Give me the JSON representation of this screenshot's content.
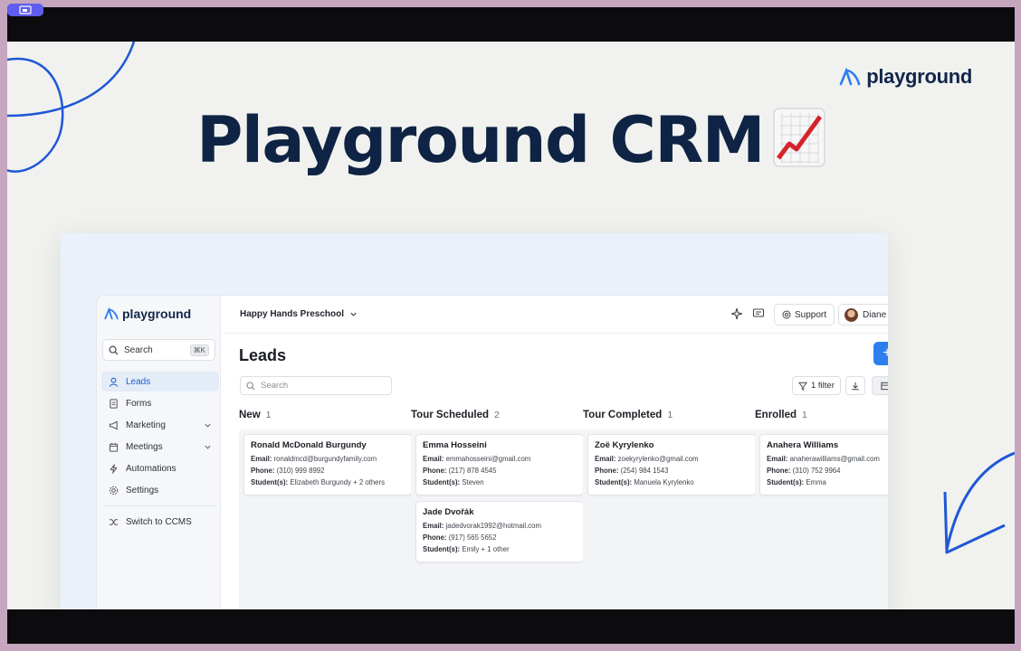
{
  "colors": {
    "accent": "#2d7ff0",
    "brand_navy": "#0f2444",
    "deco_blue": "#1f57d6"
  },
  "slide": {
    "brand": "playground",
    "headline": "Playground CRM",
    "headline_emoji": "chart-increasing-icon"
  },
  "app": {
    "sidebar": {
      "logo": "playground",
      "search_label": "Search",
      "search_shortcut": "⌘K",
      "items": [
        {
          "label": "Leads",
          "icon": "user-icon",
          "active": true
        },
        {
          "label": "Forms",
          "icon": "document-icon"
        },
        {
          "label": "Marketing",
          "icon": "megaphone-icon",
          "expandable": true
        },
        {
          "label": "Meetings",
          "icon": "calendar-icon",
          "expandable": true
        },
        {
          "label": "Automations",
          "icon": "lightning-icon"
        },
        {
          "label": "Settings",
          "icon": "gear-icon"
        }
      ],
      "switch_label": "Switch to CCMS"
    },
    "topbar": {
      "school": "Happy Hands Preschool",
      "support": "Support",
      "user": "Diane"
    },
    "page_title": "Leads",
    "add_button": "+",
    "search_placeholder": "Search",
    "filter_label": "1 filter",
    "columns": [
      {
        "title": "New",
        "count": "1",
        "cards": [
          {
            "name": "Ronald McDonald Burgundy",
            "email": "ronaldmcd@burgundyfamily.com",
            "phone": "(310) 999 8992",
            "students": "Elizabeth Burgundy + 2 others"
          }
        ]
      },
      {
        "title": "Tour Scheduled",
        "count": "2",
        "cards": [
          {
            "name": "Emma Hosseini",
            "email": "emmahosseini@gmail.com",
            "phone": "(217) 878 4545",
            "students": "Steven"
          },
          {
            "name": "Jade Dvořák",
            "email": "jadedvorak1992@hotmail.com",
            "phone": "(917) 565 5652",
            "students": "Emily + 1 other"
          }
        ]
      },
      {
        "title": "Tour Completed",
        "count": "1",
        "cards": [
          {
            "name": "Zoë Kyrylenko",
            "email": "zoekyrylenko@gmail.com",
            "phone": "(254) 984 1543",
            "students": "Manuela Kyrylenko"
          }
        ]
      },
      {
        "title": "Enrolled",
        "count": "1",
        "cards": [
          {
            "name": "Anahera Williams",
            "email": "anaherawilliams@gmail.com",
            "phone": "(310) 752 9964",
            "students": "Emma"
          }
        ]
      }
    ],
    "field_labels": {
      "email": "Email:",
      "phone": "Phone:",
      "students": "Student(s):"
    }
  }
}
